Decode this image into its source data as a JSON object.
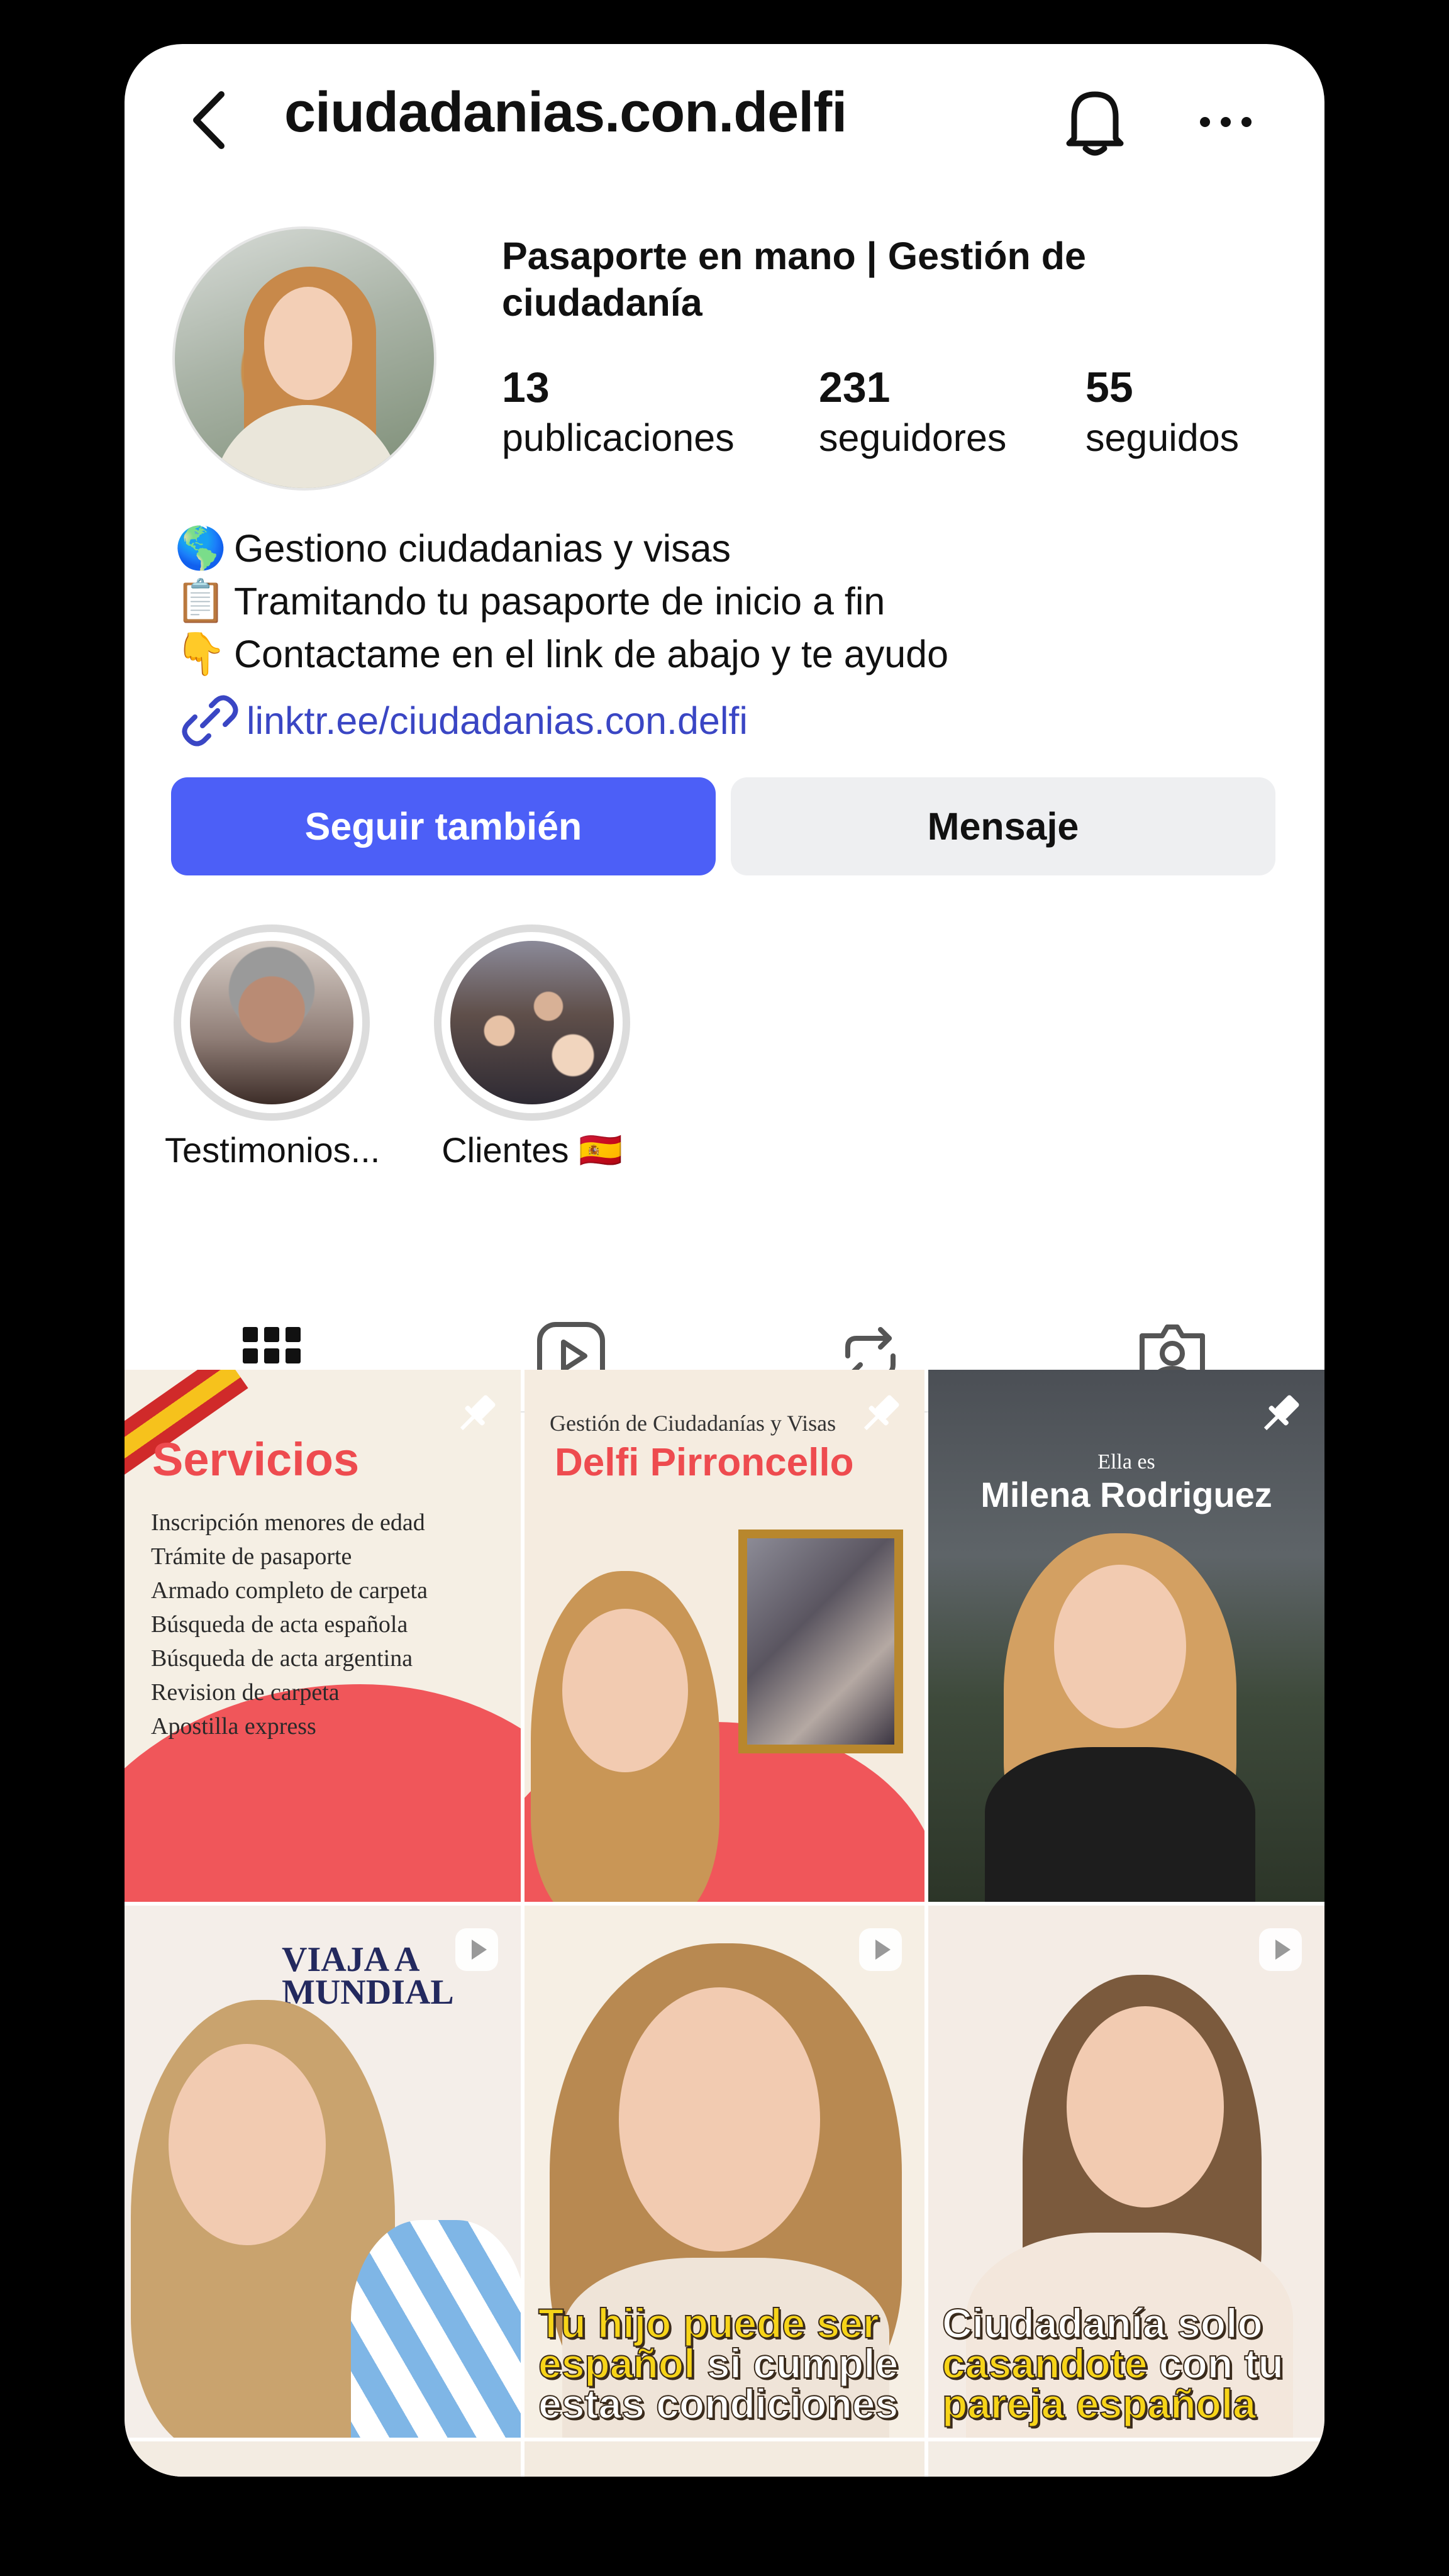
{
  "header": {
    "username": "ciudadanias.con.delfi",
    "back_icon": "chevron-left-icon",
    "bell_icon": "bell-icon",
    "more_icon": "more-horizontal-icon"
  },
  "profile": {
    "display_name": "Pasaporte en mano | Gestión de ciudadanía",
    "stats": [
      {
        "num": "13",
        "label": "publicaciones"
      },
      {
        "num": "231",
        "label": "seguidores"
      },
      {
        "num": "55",
        "label": "seguidos"
      }
    ],
    "bio": [
      {
        "emoji": "🌎",
        "text": "Gestiono ciudadanias y visas"
      },
      {
        "emoji": "📋",
        "text": "Tramitando tu pasaporte de inicio a fin"
      },
      {
        "emoji": "👇",
        "text": "Contactame en el link de abajo y te ayudo"
      }
    ],
    "link": "linktr.ee/ciudadanias.con.delfi"
  },
  "actions": {
    "follow_label": "Seguir también",
    "message_label": "Mensaje",
    "follow_color": "#4c5ff7"
  },
  "highlights": [
    {
      "label": "Testimonios..."
    },
    {
      "label": "Clientes 🇪🇸"
    }
  ],
  "tabs": [
    "grid-icon",
    "reels-icon",
    "reposts-icon",
    "tagged-icon"
  ],
  "posts": {
    "t1": {
      "title": "Servicios",
      "items": [
        "Inscripción menores de edad",
        "Trámite de pasaporte",
        "Armado completo de carpeta",
        "Búsqueda de acta española",
        "Búsqueda de acta argentina",
        "Revision de carpeta",
        "Apostilla express"
      ]
    },
    "t2": {
      "top": "Gestión de Ciudadanías y Visas",
      "name": "Delfi Pirroncello"
    },
    "t3": {
      "pre": "Ella es",
      "name": "Milena Rodriguez"
    },
    "t4": {
      "title_line1": "VIAJA A",
      "title_line2": "MUNDIAL"
    },
    "t5": {
      "cap_y1": "Tu hijo puede ser",
      "cap_y2": "español",
      "cap_w2": " si cumple",
      "cap_w3": "estas condiciones"
    },
    "t6": {
      "cap_w1": "Ciudadanía solo",
      "cap_y2": "casandote",
      "cap_w2": " con tu",
      "cap_y3": "pareja española"
    }
  }
}
